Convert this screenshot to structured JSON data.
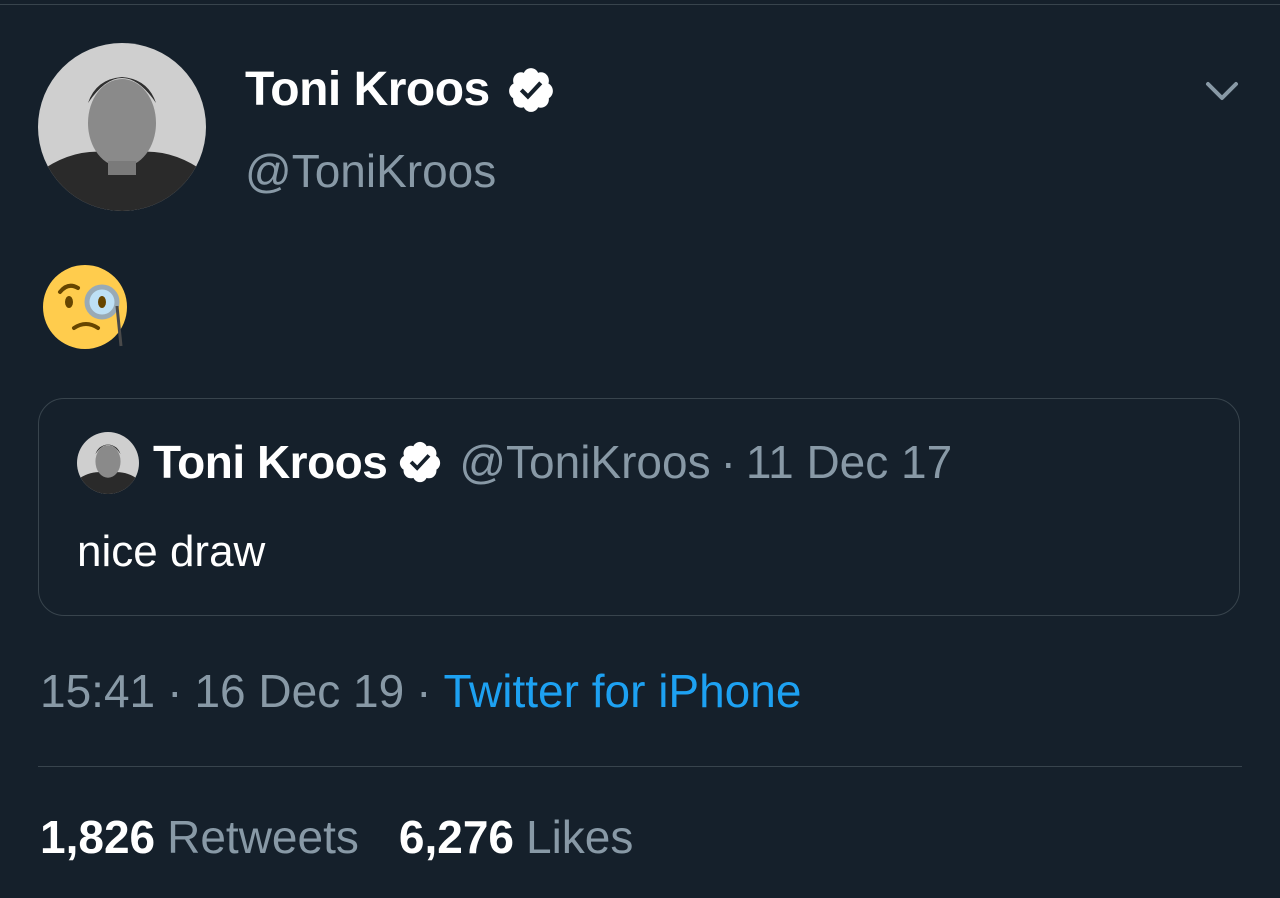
{
  "author": {
    "display_name": "Toni Kroos",
    "handle": "@ToniKroos",
    "verified": true
  },
  "tweet": {
    "emoji_icon": "face-with-monocle-icon"
  },
  "quoted_tweet": {
    "display_name": "Toni Kroos",
    "handle": "@ToniKroos",
    "separator": "·",
    "date": "11 Dec 17",
    "text": "nice draw"
  },
  "meta": {
    "time": "15:41",
    "separator": "·",
    "date": "16 Dec 19",
    "source": "Twitter for iPhone"
  },
  "stats": {
    "retweets_count": "1,826",
    "retweets_label": "Retweets",
    "likes_count": "6,276",
    "likes_label": "Likes"
  },
  "colors": {
    "background": "#15202b",
    "secondary_text": "#8899a6",
    "accent": "#1da1f2",
    "border": "#38444d"
  }
}
